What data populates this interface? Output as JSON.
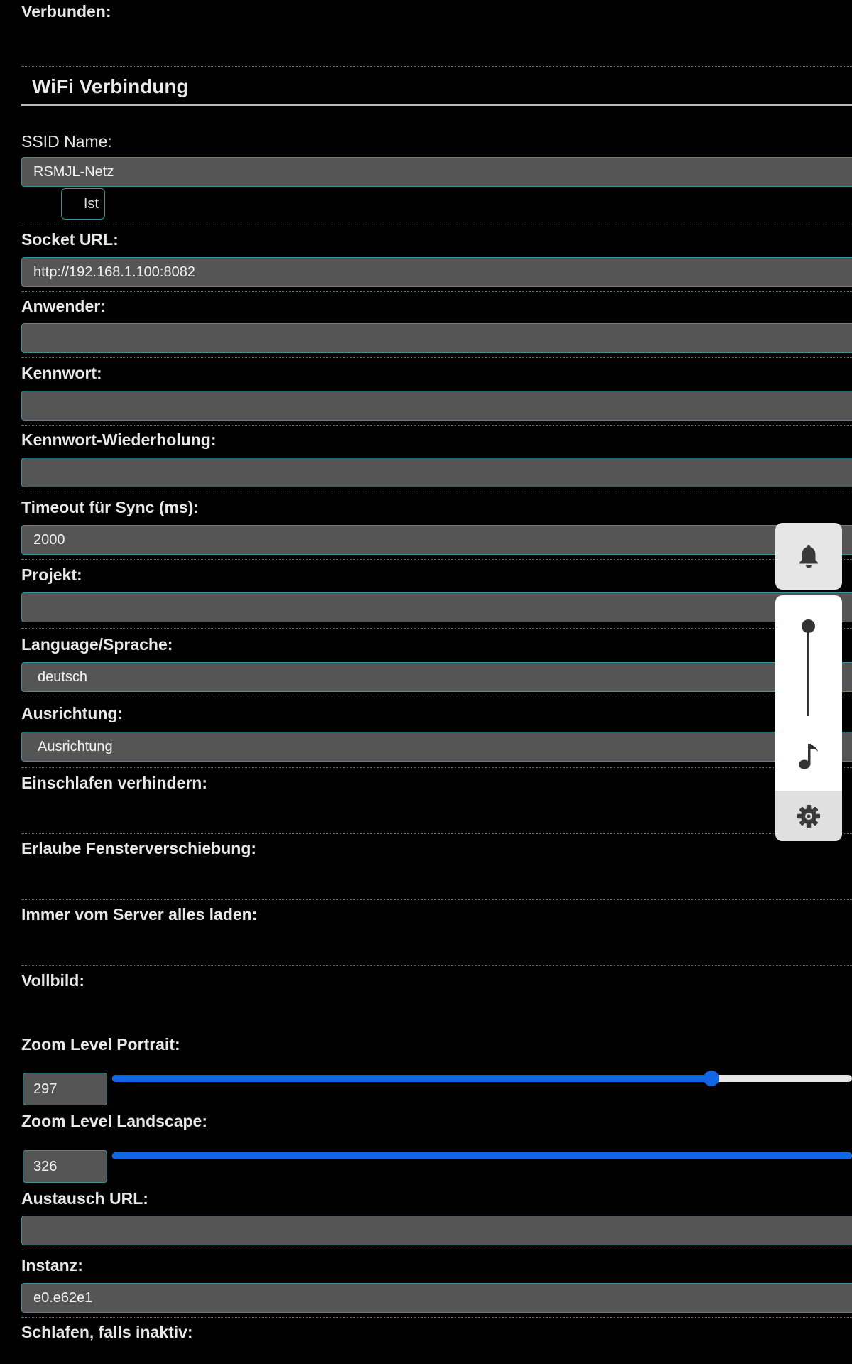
{
  "rows": {
    "connected_label": "Verbunden:",
    "section_title": "WiFi Verbindung",
    "ssid_label": "SSID Name:",
    "ssid_value": "RSMJL-Netz",
    "ist_button": "Ist",
    "socket_label": "Socket URL:",
    "socket_value": "http://192.168.1.100:8082",
    "user_label": "Anwender:",
    "user_value": "",
    "password_label": "Kennwort:",
    "password_value": "",
    "password_repeat_label": "Kennwort-Wiederholung:",
    "password_repeat_value": "",
    "timeout_label": "Timeout für Sync (ms):",
    "timeout_value": "2000",
    "project_label": "Projekt:",
    "project_value": "",
    "language_label": "Language/Sprache:",
    "language_value": "deutsch",
    "orientation_label": "Ausrichtung:",
    "orientation_value": "Ausrichtung",
    "prevent_sleep_label": "Einschlafen verhindern:",
    "allow_move_label": "Erlaube Fensterverschiebung:",
    "always_load_label": "Immer vom Server alles laden:",
    "fullscreen_label": "Vollbild:",
    "zoom_portrait_label": "Zoom Level Portrait:",
    "zoom_portrait_value": "297",
    "zoom_landscape_label": "Zoom Level Landscape:",
    "zoom_landscape_value": "326",
    "exchange_url_label": "Austausch URL:",
    "exchange_url_value": "",
    "instance_label": "Instanz:",
    "instance_value": "e0.e62e1",
    "sleep_inactive_label": "Schlafen, falls inaktiv:"
  },
  "sliders": {
    "portrait_fill_fraction": 0.81,
    "landscape_fill_fraction": 1.0
  },
  "floating_panel": {
    "bell_icon": "bell-icon",
    "volume_level": 1.0,
    "note_icon": "music-note-icon",
    "gear_icon": "gear-icon"
  },
  "colors": {
    "background": "#000000",
    "field": "#555555",
    "field_border": "#3f8f96",
    "slider_accent": "#1266e6"
  }
}
